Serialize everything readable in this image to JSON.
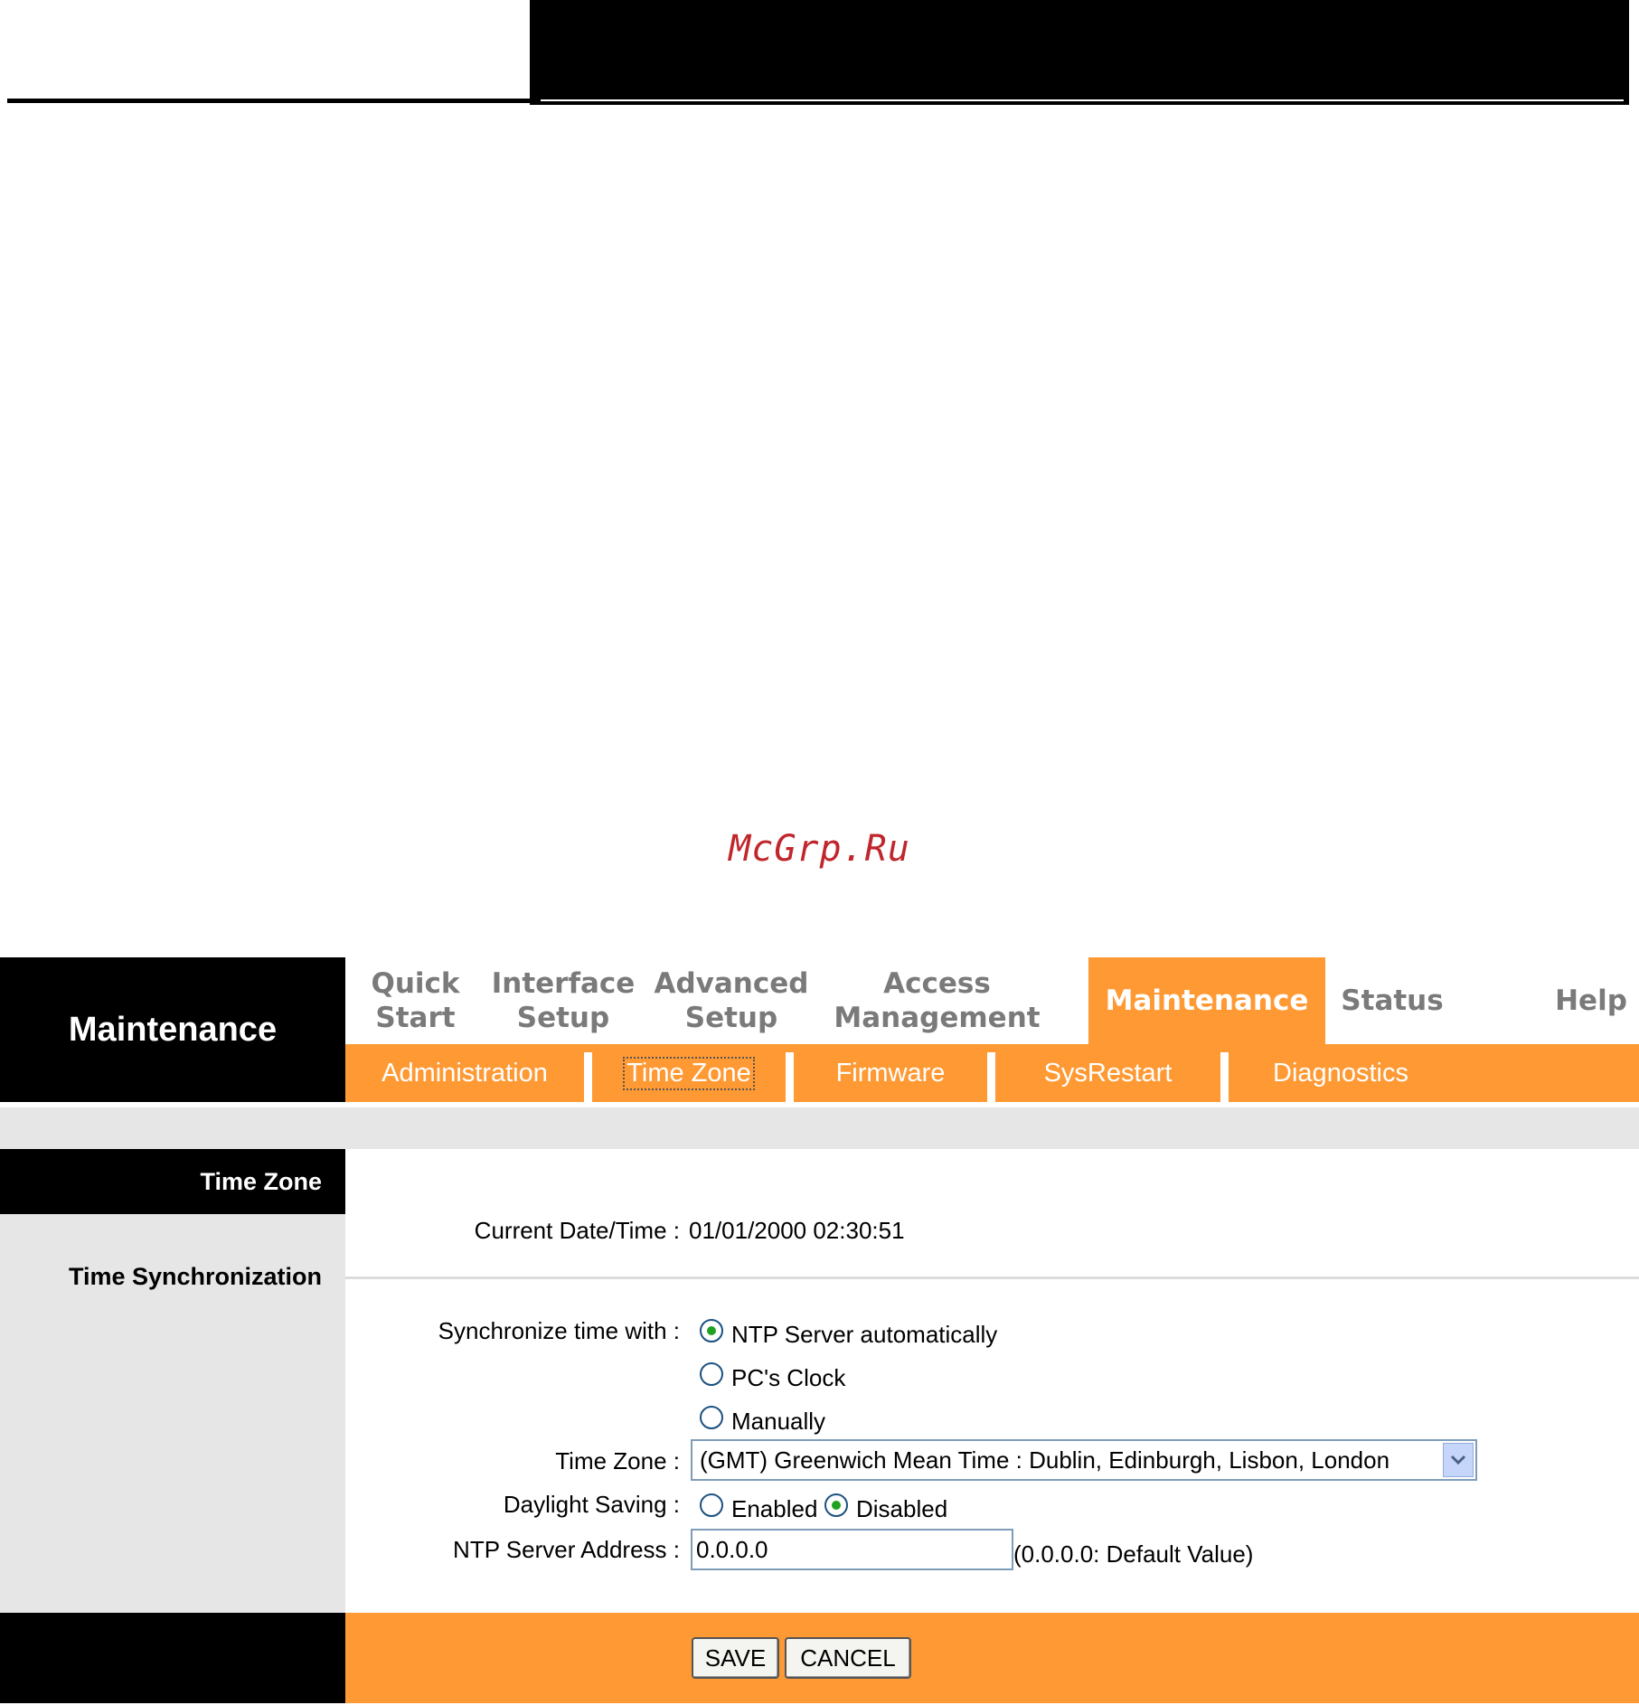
{
  "watermark": "McGrp.Ru",
  "section_title": "Maintenance",
  "main_nav": [
    {
      "label": "Quick\nStart",
      "active": false
    },
    {
      "label": "Interface\nSetup",
      "active": false
    },
    {
      "label": "Advanced\nSetup",
      "active": false
    },
    {
      "label": "Access\nManagement",
      "active": false
    },
    {
      "label": "Maintenance",
      "active": true
    },
    {
      "label": "Status",
      "active": false
    },
    {
      "label": "Help",
      "active": false
    }
  ],
  "sub_nav": [
    {
      "label": "Administration",
      "active": false
    },
    {
      "label": "Time Zone",
      "active": true
    },
    {
      "label": "Firmware",
      "active": false
    },
    {
      "label": "SysRestart",
      "active": false
    },
    {
      "label": "Diagnostics",
      "active": false
    }
  ],
  "left": {
    "time_zone_heading": "Time Zone",
    "time_sync_heading": "Time Synchronization"
  },
  "form": {
    "current_datetime_label": "Current Date/Time :",
    "current_datetime_value": "01/01/2000 02:30:51",
    "sync_label": "Synchronize time with :",
    "sync_options": [
      "NTP Server automatically",
      "PC's Clock",
      "Manually"
    ],
    "sync_selected": "NTP Server automatically",
    "timezone_label": "Time Zone :",
    "timezone_value": "(GMT) Greenwich Mean Time : Dublin, Edinburgh, Lisbon, London",
    "daylight_label": "Daylight Saving :",
    "daylight_options": [
      "Enabled",
      "Disabled"
    ],
    "daylight_selected": "Disabled",
    "ntp_label": "NTP Server Address :",
    "ntp_value": "0.0.0.0",
    "ntp_hint": "(0.0.0.0: Default Value)"
  },
  "buttons": {
    "save": "SAVE",
    "cancel": "CANCEL"
  },
  "colors": {
    "accent": "#ff9933",
    "nav_text": "#7a7a7a",
    "panel_gray": "#e6e6e6",
    "radio_dot": "#21a121"
  }
}
